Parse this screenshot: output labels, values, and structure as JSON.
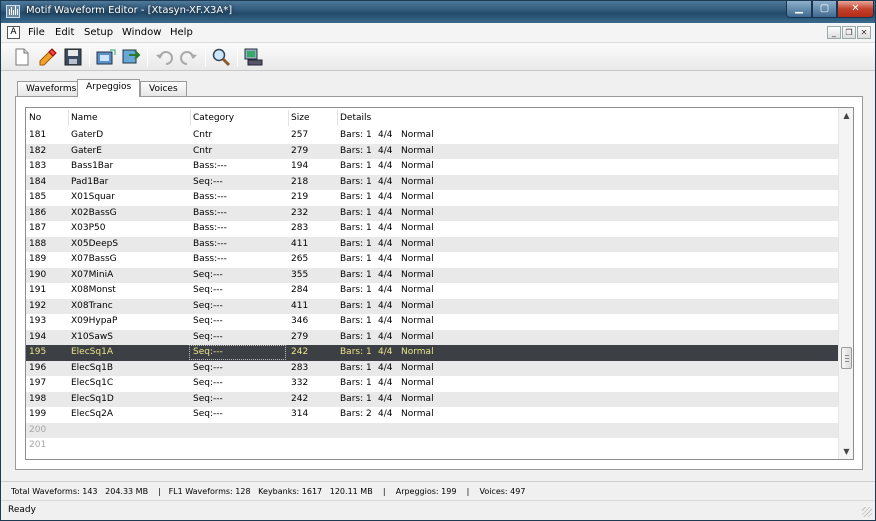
{
  "window": {
    "title": "Motif Waveform Editor - [Xtasyn-XF.X3A*]"
  },
  "menu": [
    "File",
    "Edit",
    "Setup",
    "Window",
    "Help"
  ],
  "mdi_icon_label": "A",
  "tabs": [
    {
      "label": "Waveforms",
      "active": false
    },
    {
      "label": "Arpeggios",
      "active": true
    },
    {
      "label": "Voices",
      "active": false
    }
  ],
  "list": {
    "columns": {
      "no": "No",
      "name": "Name",
      "category": "Category",
      "size": "Size",
      "details": "Details"
    },
    "rows": [
      {
        "no": "181",
        "name": "GaterD",
        "category": "Cntr",
        "size": "257",
        "bars": "Bars: 1",
        "timesig": "4/4",
        "mode": "Normal"
      },
      {
        "no": "182",
        "name": "GaterE",
        "category": "Cntr",
        "size": "279",
        "bars": "Bars: 1",
        "timesig": "4/4",
        "mode": "Normal"
      },
      {
        "no": "183",
        "name": "Bass1Bar",
        "category": "Bass:---",
        "size": "194",
        "bars": "Bars: 1",
        "timesig": "4/4",
        "mode": "Normal"
      },
      {
        "no": "184",
        "name": "Pad1Bar",
        "category": "Seq:---",
        "size": "218",
        "bars": "Bars: 1",
        "timesig": "4/4",
        "mode": "Normal"
      },
      {
        "no": "185",
        "name": "X01Squar",
        "category": "Bass:---",
        "size": "219",
        "bars": "Bars: 1",
        "timesig": "4/4",
        "mode": "Normal"
      },
      {
        "no": "186",
        "name": "X02BassG",
        "category": "Bass:---",
        "size": "232",
        "bars": "Bars: 1",
        "timesig": "4/4",
        "mode": "Normal"
      },
      {
        "no": "187",
        "name": "X03P50",
        "category": "Bass:---",
        "size": "283",
        "bars": "Bars: 1",
        "timesig": "4/4",
        "mode": "Normal"
      },
      {
        "no": "188",
        "name": "X05DeepS",
        "category": "Bass:---",
        "size": "411",
        "bars": "Bars: 1",
        "timesig": "4/4",
        "mode": "Normal"
      },
      {
        "no": "189",
        "name": "X07BassG",
        "category": "Bass:---",
        "size": "265",
        "bars": "Bars: 1",
        "timesig": "4/4",
        "mode": "Normal"
      },
      {
        "no": "190",
        "name": "X07MiniA",
        "category": "Seq:---",
        "size": "355",
        "bars": "Bars: 1",
        "timesig": "4/4",
        "mode": "Normal"
      },
      {
        "no": "191",
        "name": "X08Monst",
        "category": "Seq:---",
        "size": "284",
        "bars": "Bars: 1",
        "timesig": "4/4",
        "mode": "Normal"
      },
      {
        "no": "192",
        "name": "X08Tranc",
        "category": "Seq:---",
        "size": "411",
        "bars": "Bars: 1",
        "timesig": "4/4",
        "mode": "Normal"
      },
      {
        "no": "193",
        "name": "X09HypaP",
        "category": "Seq:---",
        "size": "346",
        "bars": "Bars: 1",
        "timesig": "4/4",
        "mode": "Normal"
      },
      {
        "no": "194",
        "name": "X10SawS",
        "category": "Seq:---",
        "size": "279",
        "bars": "Bars: 1",
        "timesig": "4/4",
        "mode": "Normal"
      },
      {
        "no": "195",
        "name": "ElecSq1A",
        "category": "Seq:---",
        "size": "242",
        "bars": "Bars: 1",
        "timesig": "4/4",
        "mode": "Normal",
        "selected": true
      },
      {
        "no": "196",
        "name": "ElecSq1B",
        "category": "Seq:---",
        "size": "283",
        "bars": "Bars: 1",
        "timesig": "4/4",
        "mode": "Normal"
      },
      {
        "no": "197",
        "name": "ElecSq1C",
        "category": "Seq:---",
        "size": "332",
        "bars": "Bars: 1",
        "timesig": "4/4",
        "mode": "Normal"
      },
      {
        "no": "198",
        "name": "ElecSq1D",
        "category": "Seq:---",
        "size": "242",
        "bars": "Bars: 1",
        "timesig": "4/4",
        "mode": "Normal"
      },
      {
        "no": "199",
        "name": "ElecSq2A",
        "category": "Seq:---",
        "size": "314",
        "bars": "Bars: 2",
        "timesig": "4/4",
        "mode": "Normal"
      },
      {
        "no": "200",
        "name": "",
        "category": "",
        "size": "",
        "bars": "",
        "timesig": "",
        "mode": "",
        "empty": true
      },
      {
        "no": "201",
        "name": "",
        "category": "",
        "size": "",
        "bars": "",
        "timesig": "",
        "mode": "",
        "empty": true
      }
    ]
  },
  "status": {
    "summary": "Total Waveforms: 143   204.33 MB    |   FL1 Waveforms: 128   Keybanks: 1617   120.11 MB    |    Arpeggios: 199    |    Voices: 497",
    "ready": "Ready"
  }
}
